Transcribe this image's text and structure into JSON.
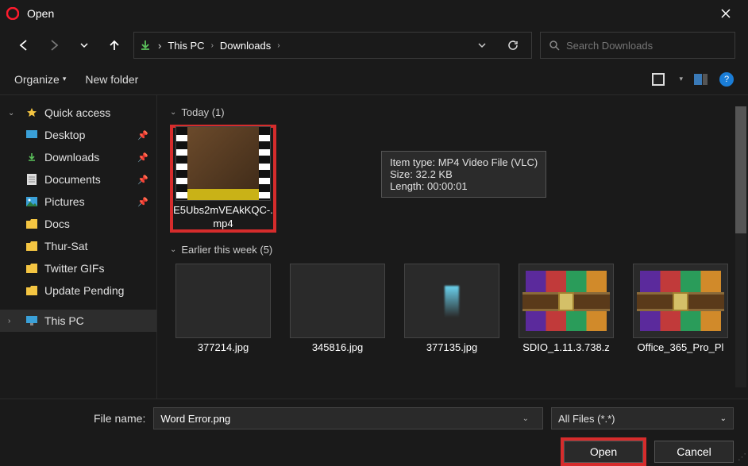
{
  "window": {
    "title": "Open"
  },
  "breadcrumb": {
    "items": [
      "This PC",
      "Downloads"
    ]
  },
  "search": {
    "placeholder": "Search Downloads"
  },
  "toolbar": {
    "organize": "Organize",
    "newfolder": "New folder"
  },
  "sidebar": {
    "quick": "Quick access",
    "items": [
      {
        "label": "Desktop",
        "icon": "desktop"
      },
      {
        "label": "Downloads",
        "icon": "download"
      },
      {
        "label": "Documents",
        "icon": "document"
      },
      {
        "label": "Pictures",
        "icon": "pictures"
      },
      {
        "label": "Docs",
        "icon": "folder"
      },
      {
        "label": "Thur-Sat",
        "icon": "folder"
      },
      {
        "label": "Twitter GIFs",
        "icon": "folder"
      },
      {
        "label": "Update Pending",
        "icon": "folder"
      }
    ],
    "thispc": "This PC"
  },
  "groups": {
    "today": "Today (1)",
    "earlier": "Earlier this week (5)"
  },
  "files": {
    "selected": {
      "name": "E5Ubs2mVEAkKQC-.mp4"
    },
    "earlier": [
      {
        "name": "377214.jpg"
      },
      {
        "name": "345816.jpg"
      },
      {
        "name": "377135.jpg"
      },
      {
        "name": "SDIO_1.11.3.738.z"
      },
      {
        "name": "Office_365_Pro_Pl"
      }
    ]
  },
  "tooltip": {
    "line1": "Item type: MP4 Video File (VLC)",
    "line2": "Size: 32.2 KB",
    "line3": "Length: 00:00:01"
  },
  "footer": {
    "filenamelabel": "File name:",
    "filename": "Word Error.png",
    "filter": "All Files (*.*)",
    "open": "Open",
    "cancel": "Cancel"
  }
}
